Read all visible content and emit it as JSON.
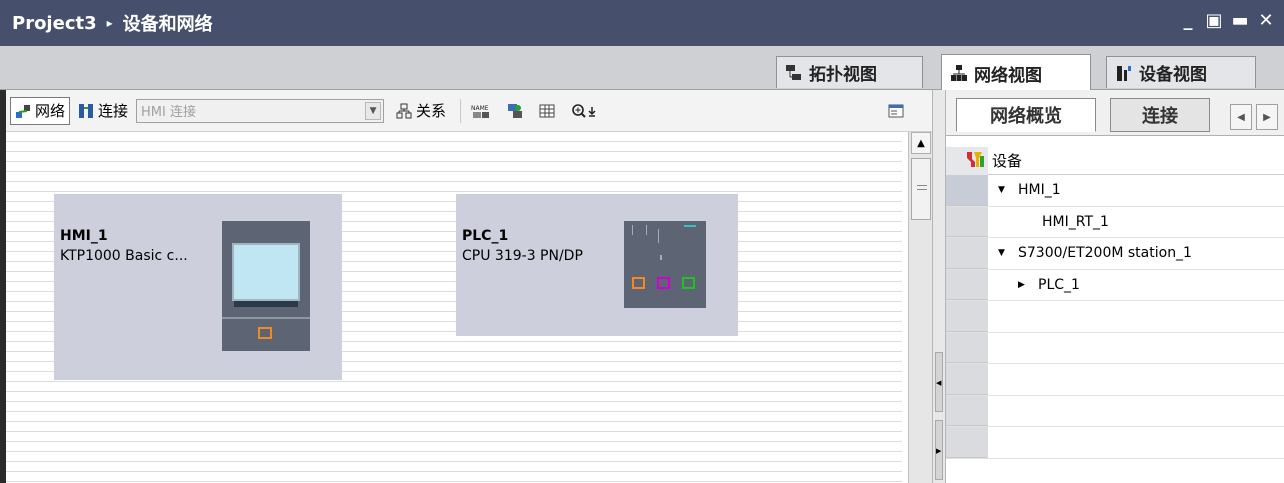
{
  "title": {
    "project": "Project3",
    "separator": "▸",
    "page": "设备和网络"
  },
  "window_controls": [
    "_",
    "▣",
    "▬",
    "✕"
  ],
  "view_tabs": [
    {
      "label": "拓扑视图",
      "icon": "topology-view-icon"
    },
    {
      "label": "网络视图",
      "icon": "network-view-icon",
      "active": true
    },
    {
      "label": "设备视图",
      "icon": "device-view-icon"
    }
  ],
  "toolbar": {
    "network_label": "网络",
    "connect_label": "连接",
    "connection_type_placeholder": "HMI 连接",
    "relations_label": "关系",
    "name_icon_text": "NAME"
  },
  "devices": [
    {
      "name": "HMI_1",
      "type": "KTP1000 Basic c..."
    },
    {
      "name": "PLC_1",
      "type": "CPU 319-3 PN/DP"
    }
  ],
  "overview": {
    "tabs": [
      "网络概览",
      "连接"
    ],
    "column_header": "设备",
    "rows": [
      {
        "label": "HMI_1",
        "expander": "▼",
        "indent": 0
      },
      {
        "label": "HMI_RT_1",
        "expander": "",
        "indent": 1
      },
      {
        "label": "S7300/ET200M station_1",
        "expander": "▼",
        "indent": 0
      },
      {
        "label": "PLC_1",
        "expander": "▶",
        "indent": 1
      },
      {
        "label": "",
        "expander": "",
        "indent": 0
      },
      {
        "label": "",
        "expander": "",
        "indent": 0
      },
      {
        "label": "",
        "expander": "",
        "indent": 0
      },
      {
        "label": "",
        "expander": "",
        "indent": 0
      },
      {
        "label": "",
        "expander": "",
        "indent": 0
      }
    ]
  },
  "colors": {
    "title_bar": "#46506c",
    "device_box": "#cdd0dc",
    "port_orange": "#f08a24",
    "port_magenta": "#d000d0",
    "port_green": "#22c022"
  }
}
